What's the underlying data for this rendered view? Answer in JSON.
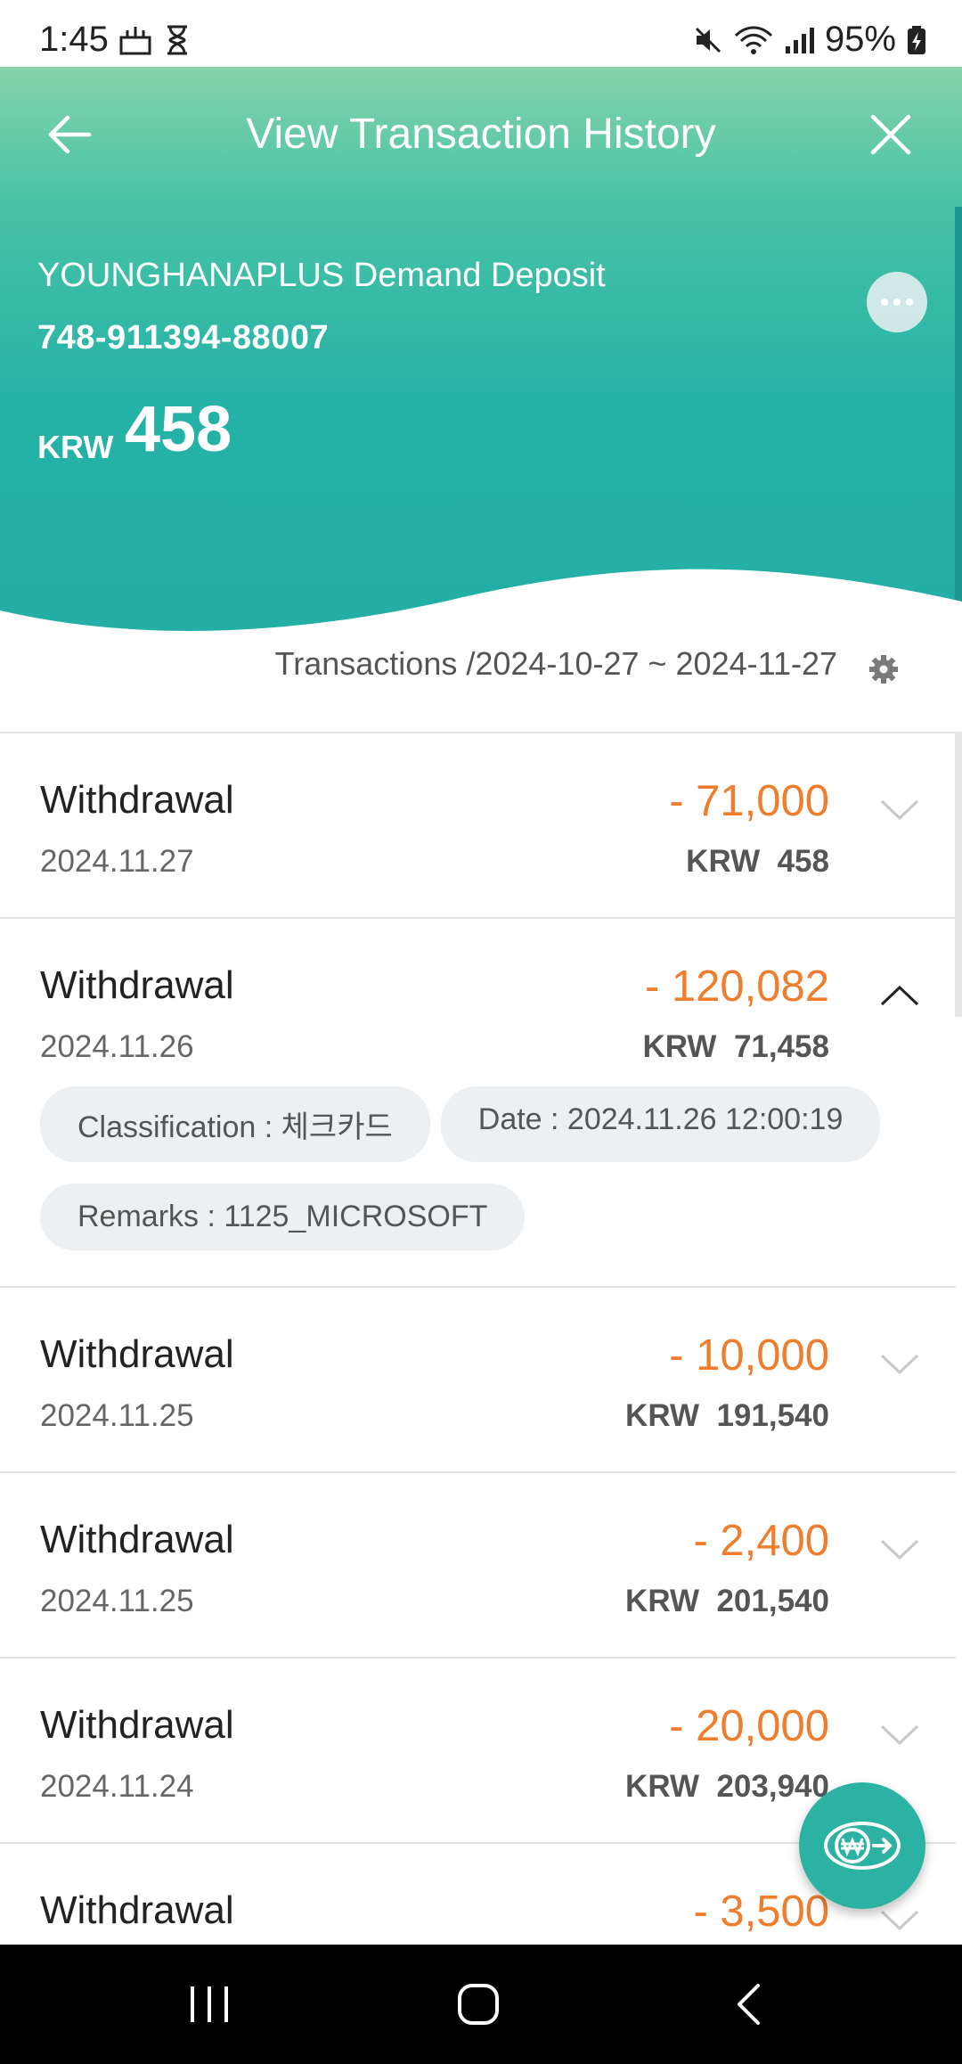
{
  "status_bar": {
    "time": "1:45",
    "battery": "95%"
  },
  "header": {
    "title": "View Transaction History"
  },
  "account": {
    "name": "YOUNGHANAPLUS Demand Deposit",
    "number": "748-911394-88007",
    "currency": "KRW",
    "balance": "458"
  },
  "period": {
    "label": "Transactions /2024-10-27 ~ 2024-11-27"
  },
  "transactions": [
    {
      "type": "Withdrawal",
      "date": "2024.11.27",
      "amount": "- 71,000",
      "balance_currency": "KRW",
      "balance": "458",
      "expanded": false
    },
    {
      "type": "Withdrawal",
      "date": "2024.11.26",
      "amount": "- 120,082",
      "balance_currency": "KRW",
      "balance": "71,458",
      "expanded": true,
      "details": {
        "classification": "Classification : 체크카드",
        "datetime": "Date : 2024.11.26 12:00:19",
        "remarks": "Remarks : 1125_MICROSOFT"
      }
    },
    {
      "type": "Withdrawal",
      "date": "2024.11.25",
      "amount": "- 10,000",
      "balance_currency": "KRW",
      "balance": "191,540",
      "expanded": false
    },
    {
      "type": "Withdrawal",
      "date": "2024.11.25",
      "amount": "- 2,400",
      "balance_currency": "KRW",
      "balance": "201,540",
      "expanded": false
    },
    {
      "type": "Withdrawal",
      "date": "2024.11.24",
      "amount": "- 20,000",
      "balance_currency": "KRW",
      "balance": "203,940",
      "expanded": false
    },
    {
      "type": "Withdrawal",
      "date": "",
      "amount": "- 3,500",
      "balance_currency": "",
      "balance": "",
      "expanded": false
    }
  ],
  "colors": {
    "header_top": "#86d3a8",
    "header_bottom": "#23aea6",
    "amount": "#ef7d2c",
    "fab": "#2bb2a3"
  },
  "icons": {
    "back": "arrow-left-icon",
    "close": "close-icon",
    "more": "more-horizontal-icon",
    "settings": "gear-icon",
    "fab": "currency-exchange-icon"
  }
}
